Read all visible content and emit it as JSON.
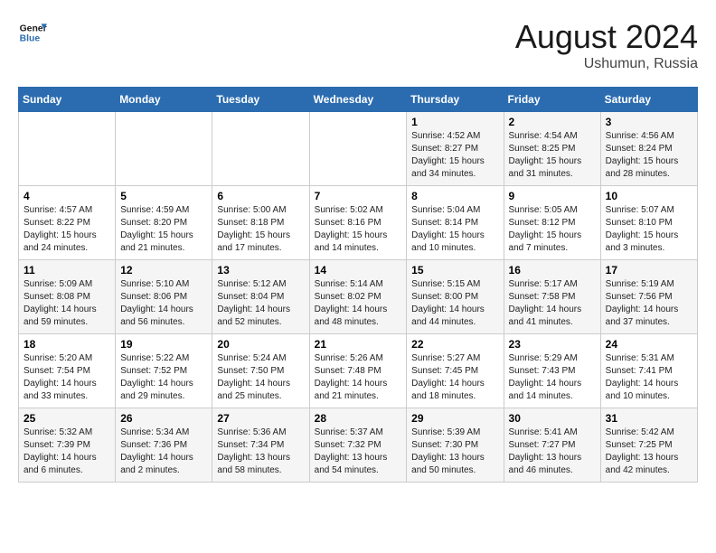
{
  "logo": {
    "line1": "General",
    "line2": "Blue"
  },
  "title": "August 2024",
  "subtitle": "Ushumun, Russia",
  "days_of_week": [
    "Sunday",
    "Monday",
    "Tuesday",
    "Wednesday",
    "Thursday",
    "Friday",
    "Saturday"
  ],
  "weeks": [
    [
      {
        "num": "",
        "info": ""
      },
      {
        "num": "",
        "info": ""
      },
      {
        "num": "",
        "info": ""
      },
      {
        "num": "",
        "info": ""
      },
      {
        "num": "1",
        "info": "Sunrise: 4:52 AM\nSunset: 8:27 PM\nDaylight: 15 hours\nand 34 minutes."
      },
      {
        "num": "2",
        "info": "Sunrise: 4:54 AM\nSunset: 8:25 PM\nDaylight: 15 hours\nand 31 minutes."
      },
      {
        "num": "3",
        "info": "Sunrise: 4:56 AM\nSunset: 8:24 PM\nDaylight: 15 hours\nand 28 minutes."
      }
    ],
    [
      {
        "num": "4",
        "info": "Sunrise: 4:57 AM\nSunset: 8:22 PM\nDaylight: 15 hours\nand 24 minutes."
      },
      {
        "num": "5",
        "info": "Sunrise: 4:59 AM\nSunset: 8:20 PM\nDaylight: 15 hours\nand 21 minutes."
      },
      {
        "num": "6",
        "info": "Sunrise: 5:00 AM\nSunset: 8:18 PM\nDaylight: 15 hours\nand 17 minutes."
      },
      {
        "num": "7",
        "info": "Sunrise: 5:02 AM\nSunset: 8:16 PM\nDaylight: 15 hours\nand 14 minutes."
      },
      {
        "num": "8",
        "info": "Sunrise: 5:04 AM\nSunset: 8:14 PM\nDaylight: 15 hours\nand 10 minutes."
      },
      {
        "num": "9",
        "info": "Sunrise: 5:05 AM\nSunset: 8:12 PM\nDaylight: 15 hours\nand 7 minutes."
      },
      {
        "num": "10",
        "info": "Sunrise: 5:07 AM\nSunset: 8:10 PM\nDaylight: 15 hours\nand 3 minutes."
      }
    ],
    [
      {
        "num": "11",
        "info": "Sunrise: 5:09 AM\nSunset: 8:08 PM\nDaylight: 14 hours\nand 59 minutes."
      },
      {
        "num": "12",
        "info": "Sunrise: 5:10 AM\nSunset: 8:06 PM\nDaylight: 14 hours\nand 56 minutes."
      },
      {
        "num": "13",
        "info": "Sunrise: 5:12 AM\nSunset: 8:04 PM\nDaylight: 14 hours\nand 52 minutes."
      },
      {
        "num": "14",
        "info": "Sunrise: 5:14 AM\nSunset: 8:02 PM\nDaylight: 14 hours\nand 48 minutes."
      },
      {
        "num": "15",
        "info": "Sunrise: 5:15 AM\nSunset: 8:00 PM\nDaylight: 14 hours\nand 44 minutes."
      },
      {
        "num": "16",
        "info": "Sunrise: 5:17 AM\nSunset: 7:58 PM\nDaylight: 14 hours\nand 41 minutes."
      },
      {
        "num": "17",
        "info": "Sunrise: 5:19 AM\nSunset: 7:56 PM\nDaylight: 14 hours\nand 37 minutes."
      }
    ],
    [
      {
        "num": "18",
        "info": "Sunrise: 5:20 AM\nSunset: 7:54 PM\nDaylight: 14 hours\nand 33 minutes."
      },
      {
        "num": "19",
        "info": "Sunrise: 5:22 AM\nSunset: 7:52 PM\nDaylight: 14 hours\nand 29 minutes."
      },
      {
        "num": "20",
        "info": "Sunrise: 5:24 AM\nSunset: 7:50 PM\nDaylight: 14 hours\nand 25 minutes."
      },
      {
        "num": "21",
        "info": "Sunrise: 5:26 AM\nSunset: 7:48 PM\nDaylight: 14 hours\nand 21 minutes."
      },
      {
        "num": "22",
        "info": "Sunrise: 5:27 AM\nSunset: 7:45 PM\nDaylight: 14 hours\nand 18 minutes."
      },
      {
        "num": "23",
        "info": "Sunrise: 5:29 AM\nSunset: 7:43 PM\nDaylight: 14 hours\nand 14 minutes."
      },
      {
        "num": "24",
        "info": "Sunrise: 5:31 AM\nSunset: 7:41 PM\nDaylight: 14 hours\nand 10 minutes."
      }
    ],
    [
      {
        "num": "25",
        "info": "Sunrise: 5:32 AM\nSunset: 7:39 PM\nDaylight: 14 hours\nand 6 minutes."
      },
      {
        "num": "26",
        "info": "Sunrise: 5:34 AM\nSunset: 7:36 PM\nDaylight: 14 hours\nand 2 minutes."
      },
      {
        "num": "27",
        "info": "Sunrise: 5:36 AM\nSunset: 7:34 PM\nDaylight: 13 hours\nand 58 minutes."
      },
      {
        "num": "28",
        "info": "Sunrise: 5:37 AM\nSunset: 7:32 PM\nDaylight: 13 hours\nand 54 minutes."
      },
      {
        "num": "29",
        "info": "Sunrise: 5:39 AM\nSunset: 7:30 PM\nDaylight: 13 hours\nand 50 minutes."
      },
      {
        "num": "30",
        "info": "Sunrise: 5:41 AM\nSunset: 7:27 PM\nDaylight: 13 hours\nand 46 minutes."
      },
      {
        "num": "31",
        "info": "Sunrise: 5:42 AM\nSunset: 7:25 PM\nDaylight: 13 hours\nand 42 minutes."
      }
    ]
  ]
}
